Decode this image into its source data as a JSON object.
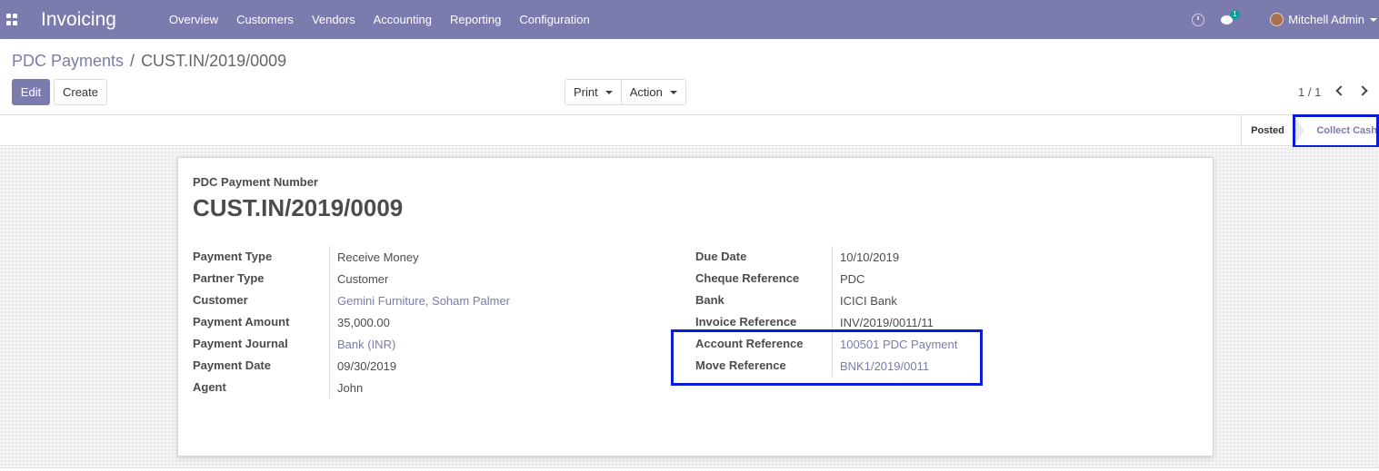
{
  "navbar": {
    "app_name": "Invoicing",
    "menu": [
      "Overview",
      "Customers",
      "Vendors",
      "Accounting",
      "Reporting",
      "Configuration"
    ],
    "message_count": "1",
    "user": "Mitchell Admin"
  },
  "breadcrumb": {
    "parent": "PDC Payments",
    "separator": "/",
    "current": "CUST.IN/2019/0009"
  },
  "buttons": {
    "edit": "Edit",
    "create": "Create",
    "print": "Print",
    "action": "Action"
  },
  "pager": "1 / 1",
  "status": {
    "posted": "Posted",
    "collect_cash": "Collect Cash"
  },
  "form": {
    "number_label": "PDC Payment Number",
    "number": "CUST.IN/2019/0009",
    "left": [
      {
        "label": "Payment Type",
        "value": "Receive Money"
      },
      {
        "label": "Partner Type",
        "value": "Customer"
      },
      {
        "label": "Customer",
        "value": "Gemini Furniture, Soham Palmer"
      },
      {
        "label": "Payment Amount",
        "value": "35,000.00"
      },
      {
        "label": "Payment Journal",
        "value": "Bank (INR)"
      },
      {
        "label": "Payment Date",
        "value": "09/30/2019"
      },
      {
        "label": "Agent",
        "value": "John"
      }
    ],
    "right": [
      {
        "label": "Due Date",
        "value": "10/10/2019"
      },
      {
        "label": "Cheque Reference",
        "value": "PDC"
      },
      {
        "label": "Bank",
        "value": "ICICI Bank"
      },
      {
        "label": "Invoice Reference",
        "value": "INV/2019/0011/11"
      },
      {
        "label": "Account Reference",
        "value": "100501 PDC Payment"
      },
      {
        "label": "Move Reference",
        "value": "BNK1/2019/0011"
      }
    ]
  },
  "colors": {
    "brand": "#7c7bad",
    "highlight": "#0b1cd6",
    "badge": "#00a09d"
  }
}
